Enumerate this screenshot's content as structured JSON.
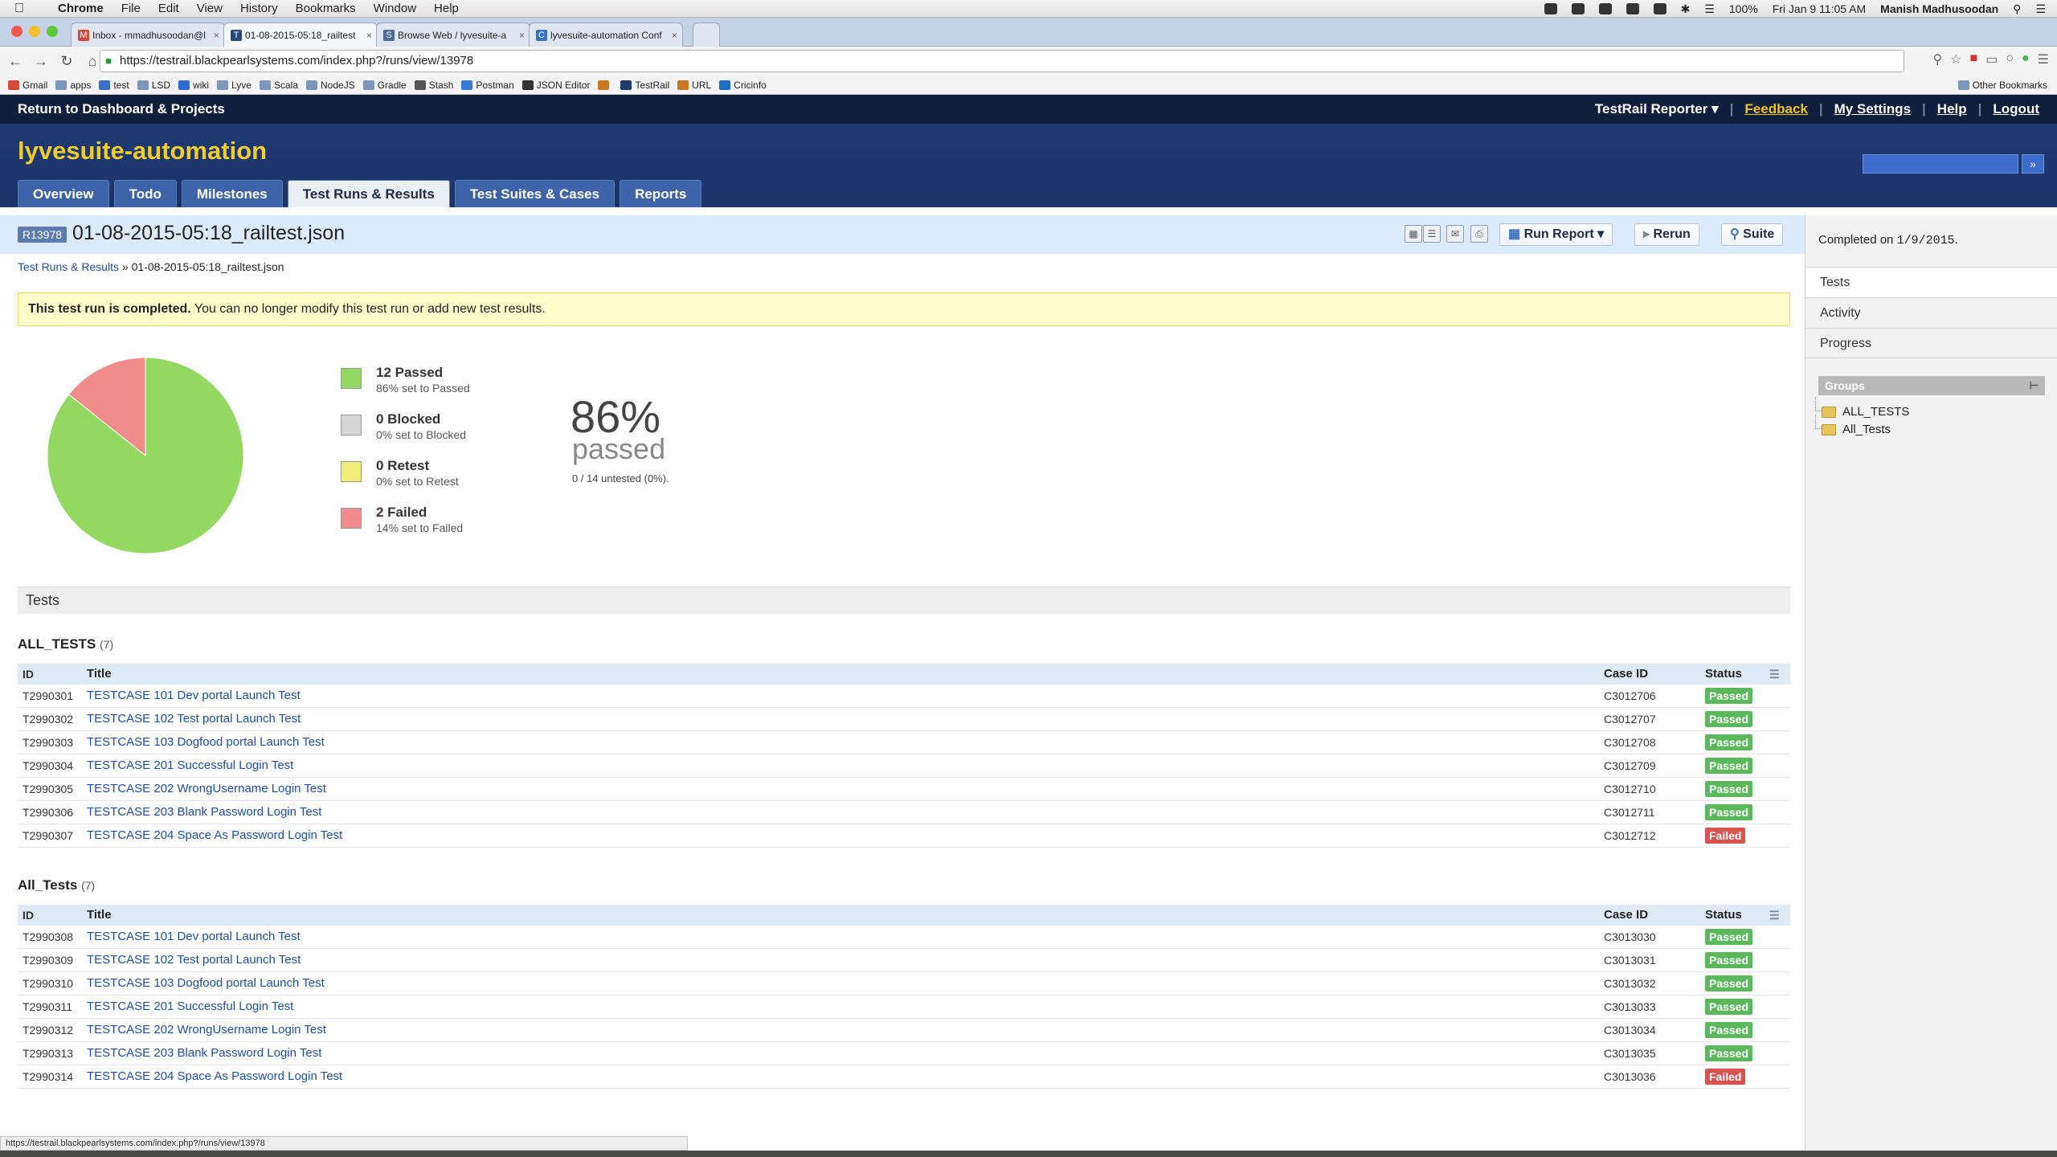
{
  "menubar": {
    "app": "Chrome",
    "items": [
      "File",
      "Edit",
      "View",
      "History",
      "Bookmarks",
      "Window",
      "Help"
    ],
    "battery": "100%",
    "clock": "Fri Jan 9  11:05 AM",
    "user": "Manish Madhusoodan"
  },
  "tabs": [
    {
      "label": "Inbox - mmadhusoodan@l"
    },
    {
      "label": "01-08-2015-05:18_railtest"
    },
    {
      "label": "Browse Web / lyvesuite-a"
    },
    {
      "label": "lyvesuite-automation Conf"
    }
  ],
  "browser": {
    "url": "https://testrail.blackpearlsystems.com/index.php?/runs/view/13978"
  },
  "bookmarks": [
    "Gmail",
    "apps",
    "test",
    "LSD",
    "wiki",
    "Lyve",
    "Scala",
    "NodeJS",
    "Gradle",
    "Stash",
    "Postman",
    "JSON Editor",
    "",
    "TestRail",
    "URL",
    "Cricinfo"
  ],
  "bookmarks_other": "Other Bookmarks",
  "topbar": {
    "back": "Return to Dashboard & Projects",
    "reporter": "TestRail Reporter",
    "feedback": "Feedback",
    "settings": "My Settings",
    "help": "Help",
    "logout": "Logout"
  },
  "project": "lyvesuite-automation",
  "navtabs": [
    "Overview",
    "Todo",
    "Milestones",
    "Test Runs & Results",
    "Test Suites & Cases",
    "Reports"
  ],
  "run": {
    "badge": "R13978",
    "title": "01-08-2015-05:18_railtest.json",
    "run_report": "Run Report",
    "rerun": "Rerun",
    "suite": "Suite"
  },
  "breadcrumb": {
    "link": "Test Runs & Results",
    "sep": "»",
    "current": "01-08-2015-05:18_railtest.json"
  },
  "notice": {
    "bold": "This test run is completed.",
    "text": " You can no longer modify this test run or add new test results."
  },
  "stats": {
    "items": [
      {
        "title": "12 Passed",
        "sub": "86% set to Passed",
        "color": "#93d861",
        "value": 12
      },
      {
        "title": "0 Blocked",
        "sub": "0% set to Blocked",
        "color": "#d6d6d6",
        "value": 0
      },
      {
        "title": "0 Retest",
        "sub": "0% set to Retest",
        "color": "#f0ee78",
        "value": 0
      },
      {
        "title": "2 Failed",
        "sub": "14% set to Failed",
        "color": "#f08c8c",
        "value": 2
      }
    ],
    "big_pct": "86%",
    "big_word": "passed",
    "untested": "0 / 14 untested (0%)."
  },
  "tests_heading": "Tests",
  "table_headers": {
    "id": "ID",
    "title": "Title",
    "case": "Case ID",
    "status": "Status"
  },
  "groups": [
    {
      "name": "ALL_TESTS",
      "count": "(7)",
      "rows": [
        {
          "id": "T2990301",
          "title": "TESTCASE 101 Dev portal Launch Test",
          "case": "C3012706",
          "status": "Passed"
        },
        {
          "id": "T2990302",
          "title": "TESTCASE 102 Test portal Launch Test",
          "case": "C3012707",
          "status": "Passed"
        },
        {
          "id": "T2990303",
          "title": "TESTCASE 103 Dogfood portal Launch Test",
          "case": "C3012708",
          "status": "Passed"
        },
        {
          "id": "T2990304",
          "title": "TESTCASE 201 Successful Login Test",
          "case": "C3012709",
          "status": "Passed"
        },
        {
          "id": "T2990305",
          "title": "TESTCASE 202 WrongUsername Login Test",
          "case": "C3012710",
          "status": "Passed"
        },
        {
          "id": "T2990306",
          "title": "TESTCASE 203 Blank Password Login Test",
          "case": "C3012711",
          "status": "Passed"
        },
        {
          "id": "T2990307",
          "title": "TESTCASE 204 Space As Password Login Test",
          "case": "C3012712",
          "status": "Failed"
        }
      ]
    },
    {
      "name": "All_Tests",
      "count": "(7)",
      "rows": [
        {
          "id": "T2990308",
          "title": "TESTCASE 101 Dev portal Launch Test",
          "case": "C3013030",
          "status": "Passed"
        },
        {
          "id": "T2990309",
          "title": "TESTCASE 102 Test portal Launch Test",
          "case": "C3013031",
          "status": "Passed"
        },
        {
          "id": "T2990310",
          "title": "TESTCASE 103 Dogfood portal Launch Test",
          "case": "C3013032",
          "status": "Passed"
        },
        {
          "id": "T2990311",
          "title": "TESTCASE 201 Successful Login Test",
          "case": "C3013033",
          "status": "Passed"
        },
        {
          "id": "T2990312",
          "title": "TESTCASE 202 WrongUsername Login Test",
          "case": "C3013034",
          "status": "Passed"
        },
        {
          "id": "T2990313",
          "title": "TESTCASE 203 Blank Password Login Test",
          "case": "C3013035",
          "status": "Passed"
        },
        {
          "id": "T2990314",
          "title": "TESTCASE 204 Space As Password Login Test",
          "case": "C3013036",
          "status": "Failed"
        }
      ]
    }
  ],
  "sidebar": {
    "completed_prefix": "Completed on ",
    "completed_date": "1/9/2015",
    "completed_suffix": ".",
    "tabs": [
      "Tests",
      "Activity",
      "Progress"
    ],
    "groups_label": "Groups",
    "tree": [
      "ALL_TESTS",
      "All_Tests"
    ]
  },
  "statusbar": "https://testrail.blackpearlsystems.com/index.php?/runs/view/13978"
}
